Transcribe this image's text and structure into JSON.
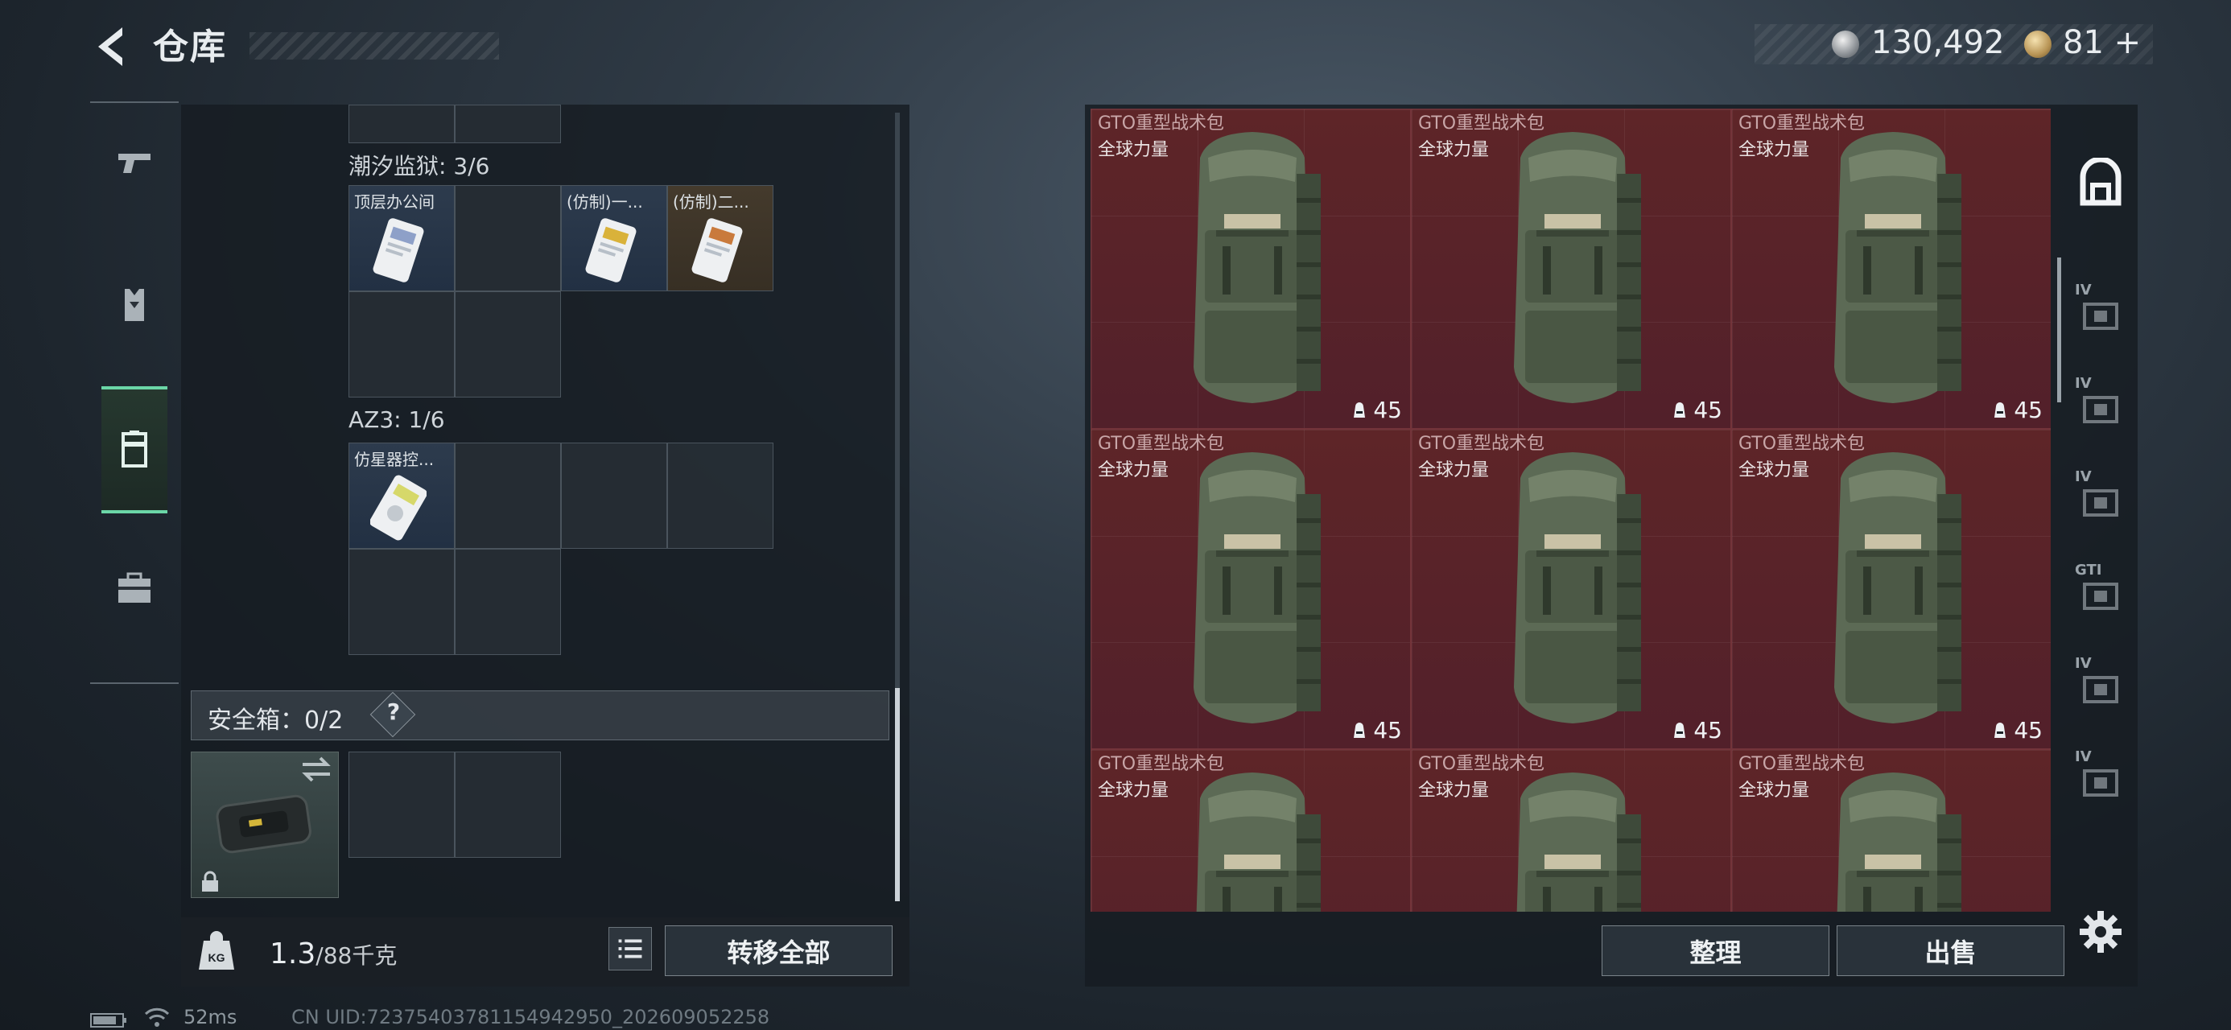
{
  "header": {
    "title": "仓库",
    "back_icon": "back-arrow-icon"
  },
  "currency": {
    "silver": "130,492",
    "gold": "81",
    "gold_plus": "+"
  },
  "left_nav": [
    {
      "name": "weapons",
      "icon": "pistol-icon"
    },
    {
      "name": "armor",
      "icon": "vest-icon"
    },
    {
      "name": "containers",
      "icon": "case-icon",
      "active": true
    },
    {
      "name": "supplies",
      "icon": "medkit-icon"
    }
  ],
  "containers": {
    "prison": {
      "label": "潮汐监狱: 3/6",
      "items": [
        "顶层办公间",
        "(仿制)一...",
        "(仿制)二..."
      ]
    },
    "az3": {
      "label": "AZ3: 1/6",
      "items": [
        "仿星器控..."
      ]
    }
  },
  "safebox": {
    "label": "安全箱：0/2",
    "help": "?"
  },
  "footer_left": {
    "weight_value": "1.3",
    "weight_unit": "/88千克",
    "transfer_label": "转移全部"
  },
  "backpack_grid": {
    "item_name": "GTO重型战术包",
    "item_sub": "全球力量",
    "count": "45",
    "cells": 9
  },
  "footer_right": {
    "sort_label": "整理",
    "sell_label": "出售"
  },
  "right_tabs": [
    {
      "name": "backpack",
      "label": ""
    },
    {
      "name": "tier-iv-1",
      "label": "IV"
    },
    {
      "name": "tier-iv-2",
      "label": "IV"
    },
    {
      "name": "tier-iv-3",
      "label": "IV"
    },
    {
      "name": "gti",
      "label": "GTI"
    },
    {
      "name": "tier-iv-4",
      "label": "IV"
    },
    {
      "name": "tier-iv-5",
      "label": "IV"
    }
  ],
  "status": {
    "ping": "52ms",
    "uid": "CN UID:7237540378115494295​0_202609052258"
  },
  "colors": {
    "accent_green": "#6bd6a7",
    "item_red": "#5e2528"
  }
}
